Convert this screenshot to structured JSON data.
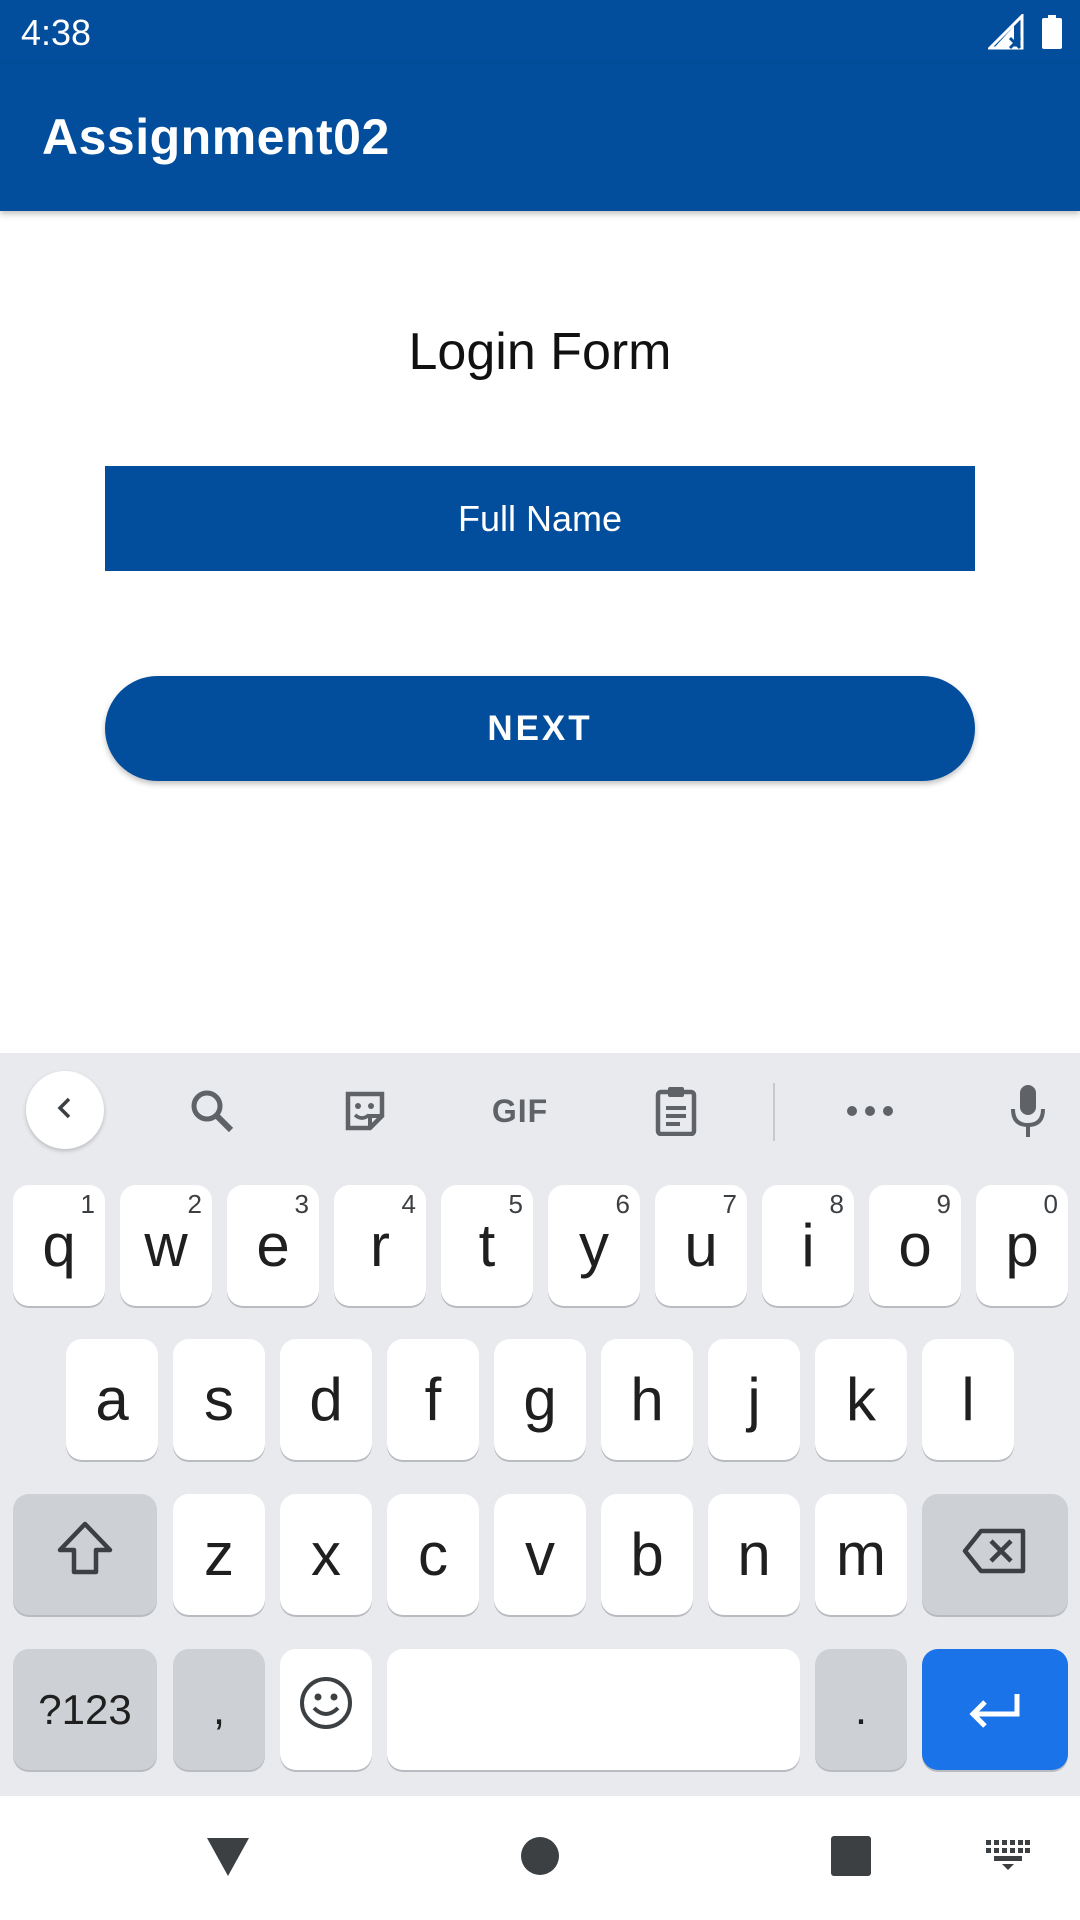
{
  "status_bar": {
    "time": "4:38"
  },
  "app_bar": {
    "title": "Assignment02"
  },
  "form": {
    "title": "Login Form",
    "name_placeholder": "Full Name",
    "next_label": "NEXT"
  },
  "keyboard": {
    "toolbar_gif_label": "GIF",
    "row1": [
      {
        "key": "q",
        "hint": "1"
      },
      {
        "key": "w",
        "hint": "2"
      },
      {
        "key": "e",
        "hint": "3"
      },
      {
        "key": "r",
        "hint": "4"
      },
      {
        "key": "t",
        "hint": "5"
      },
      {
        "key": "y",
        "hint": "6"
      },
      {
        "key": "u",
        "hint": "7"
      },
      {
        "key": "i",
        "hint": "8"
      },
      {
        "key": "o",
        "hint": "9"
      },
      {
        "key": "p",
        "hint": "0"
      }
    ],
    "row2": [
      "a",
      "s",
      "d",
      "f",
      "g",
      "h",
      "j",
      "k",
      "l"
    ],
    "row3": [
      "z",
      "x",
      "c",
      "v",
      "b",
      "n",
      "m"
    ],
    "symbols_label": "?123",
    "comma_label": ",",
    "period_label": "."
  },
  "colors": {
    "brand": "#034e9c",
    "enter_key": "#1a73e8",
    "keyboard_bg": "#e8eaed"
  }
}
